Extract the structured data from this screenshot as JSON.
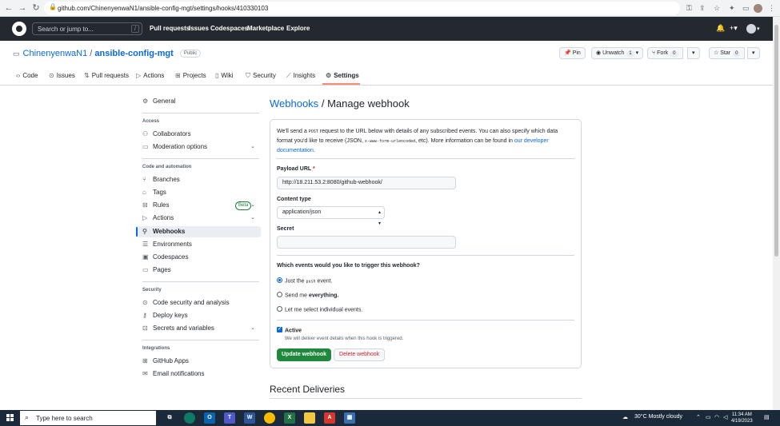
{
  "browser": {
    "url": "github.com/ChinenyenwaN1/ansible-config-mgt/settings/hooks/410330103"
  },
  "gh_header": {
    "search_placeholder": "Search or jump to...",
    "search_key": "/",
    "nav": [
      "Pull requests",
      "Issues",
      "Codespaces",
      "Marketplace",
      "Explore"
    ]
  },
  "repo": {
    "owner": "ChinenyenwaN1",
    "separator": "/",
    "name": "ansible-config-mgt",
    "visibility": "Public",
    "actions": {
      "pin": "Pin",
      "unwatch": "Unwatch",
      "unwatch_count": "1",
      "fork": "Fork",
      "fork_count": "0",
      "star": "Star",
      "star_count": "0"
    },
    "tabs": [
      "Code",
      "Issues",
      "Pull requests",
      "Actions",
      "Projects",
      "Wiki",
      "Security",
      "Insights",
      "Settings"
    ],
    "active_tab": "Settings"
  },
  "sidebar": {
    "general": "General",
    "access_heading": "Access",
    "access": [
      "Collaborators",
      "Moderation options"
    ],
    "code_heading": "Code and automation",
    "code": [
      "Branches",
      "Tags",
      "Rules",
      "Actions",
      "Webhooks",
      "Environments",
      "Codespaces",
      "Pages"
    ],
    "beta_label": "Beta",
    "security_heading": "Security",
    "security": [
      "Code security and analysis",
      "Deploy keys",
      "Secrets and variables"
    ],
    "integrations_heading": "Integrations",
    "integrations": [
      "GitHub Apps",
      "Email notifications"
    ],
    "active": "Webhooks"
  },
  "main": {
    "breadcrumb_link": "Webhooks",
    "breadcrumb_sep": "/",
    "title": "Manage webhook",
    "note": {
      "p1": "We'll send a",
      "post": "POST",
      "p2": "request to the URL below with details of any subscribed events. You can also specify which data format you'd like to receive (JSON,",
      "form": "x-www-form-urlencoded",
      "p3": ", etc). More information can be found in",
      "link": "our developer documentation",
      "p4": "."
    },
    "payload_label": "Payload URL",
    "required_mark": "*",
    "payload_value": "http://18.211.53.2:8080/github-webhook/",
    "content_type_label": "Content type",
    "content_type_value": "application/json",
    "secret_label": "Secret",
    "secret_value": "",
    "events_question": "Which events would you like to trigger this webhook?",
    "event_options": {
      "just_push_pre": "Just the",
      "just_push_code": "push",
      "just_push_post": "event.",
      "everything_pre": "Send me",
      "everything_bold": "everything.",
      "individual": "Let me select individual events."
    },
    "selected_event": "just_push",
    "active_label": "Active",
    "active_checked": true,
    "active_help": "We will deliver event details when this hook is triggered.",
    "update_button": "Update webhook",
    "delete_button": "Delete webhook",
    "recent_deliveries": "Recent Deliveries"
  },
  "taskbar": {
    "search_placeholder": "Type here to search",
    "weather": "30°C  Mostly cloudy",
    "time": "11:34 AM",
    "date": "4/19/2023"
  }
}
